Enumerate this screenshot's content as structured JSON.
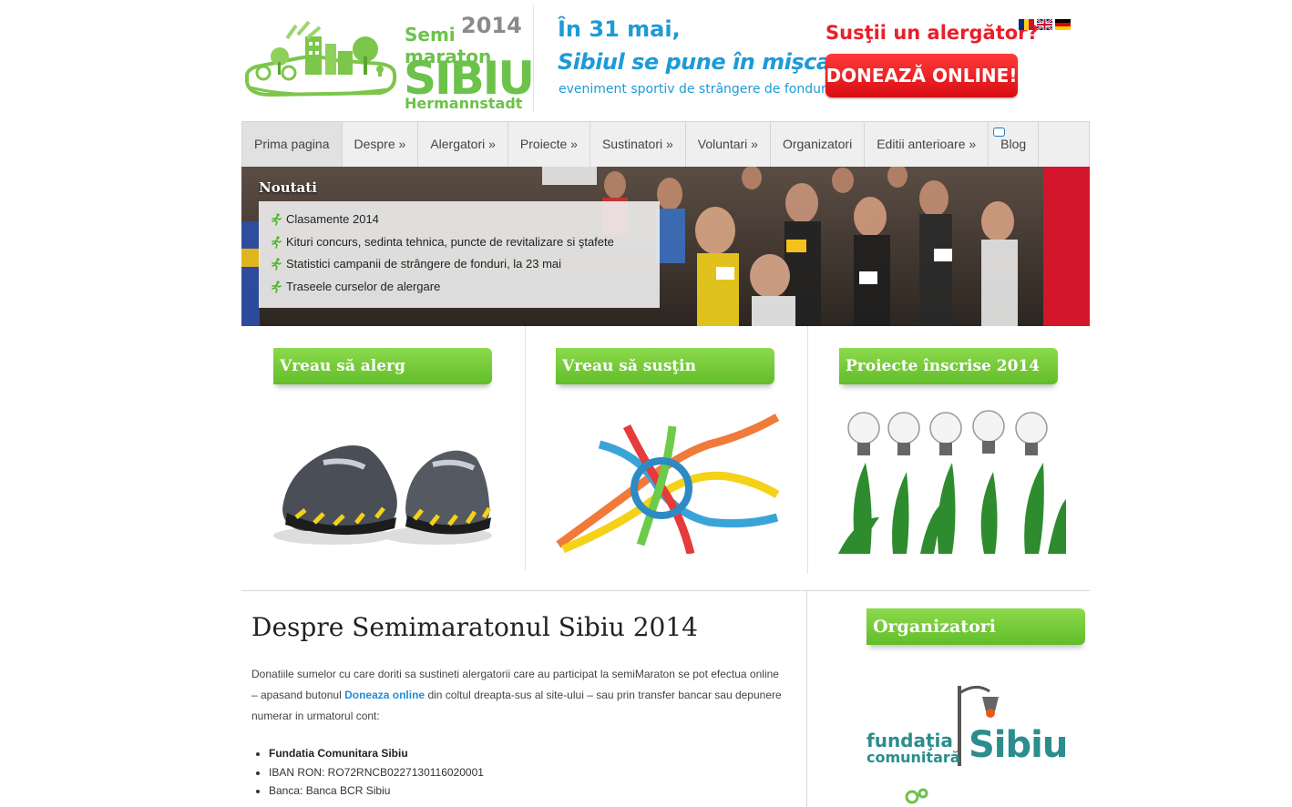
{
  "header": {
    "logo": {
      "semi": "Semi",
      "year": "2014",
      "maraton": "maraton",
      "sibiu": "SIBIU",
      "hermannstadt": "Hermannstadt"
    },
    "slogan_line1": "În 31 mai,",
    "slogan_line2": "Sibiul se pune în mişcare",
    "slogan_line3": "eveniment sportiv de strângere de fonduri",
    "support_question": "Susţii un alergător?",
    "donate_button": "DONEAZĂ ONLINE!",
    "flags": [
      "romania-flag-icon",
      "uk-flag-icon",
      "germany-flag-icon"
    ]
  },
  "nav": {
    "items": [
      {
        "label": "Prima pagina"
      },
      {
        "label": "Despre »"
      },
      {
        "label": "Alergatori »"
      },
      {
        "label": "Proiecte »"
      },
      {
        "label": "Sustinatori »"
      },
      {
        "label": "Voluntari »"
      },
      {
        "label": "Organizatori"
      },
      {
        "label": "Editii anterioare »"
      },
      {
        "label": "Blog"
      }
    ]
  },
  "hero": {
    "news_title": "Noutati",
    "news": [
      "Clasamente 2014",
      "Kituri concurs, sedinta tehnica, puncte de revitalizare si ştafete",
      "Statistici campanii de strângere de fonduri, la 23 mai",
      "Traseele curselor de alergare"
    ]
  },
  "features": [
    {
      "label": "Vreau să alerg",
      "icon": "running-shoes-image"
    },
    {
      "label": "Vreau să susţin",
      "icon": "rope-knot-image"
    },
    {
      "label": "Proiecte înscrise 2014",
      "icon": "lightbulb-tulips-image"
    }
  ],
  "content": {
    "title": "Despre Semimaratonul Sibiu 2014",
    "paragraph_part1": "Donatiile sumelor cu care doriti sa sustineti alergatorii care au participat la semiMaraton se pot efectua online – apasand butonul ",
    "paragraph_link": "Doneaza online",
    "paragraph_part2": " din coltul dreapta-sus al site-ului – sau prin transfer bancar sau depunere numerar in urmatorul cont:",
    "bank": {
      "name": "Fundatia Comunitara Sibiu",
      "iban": "IBAN RON: RO72RNCB0227130116020001",
      "bank": "Banca:  Banca BCR Sibiu"
    }
  },
  "sidebar": {
    "organizers_title": "Organizatori",
    "fund_logo_line1": "fundaţia",
    "fund_logo_line2": "comunitară",
    "fund_logo_sibiu": "Sibiu"
  },
  "colors": {
    "green": "#6cc24a",
    "blue": "#1e9ad8",
    "red": "#e8202a",
    "teal": "#2b8d8d"
  }
}
